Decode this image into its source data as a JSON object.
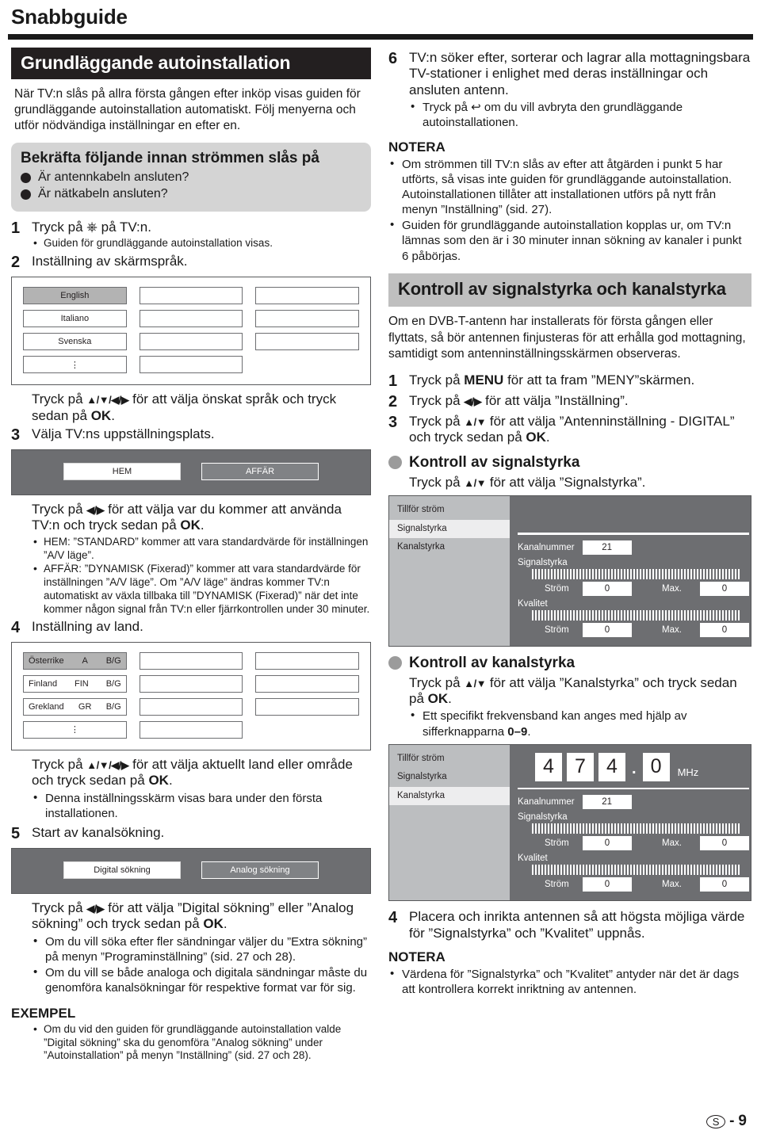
{
  "header": {
    "title": "Snabbguide"
  },
  "left": {
    "banner": "Grundläggande autoinstallation",
    "intro": "När TV:n slås på allra första gången efter inköp visas guiden för grundläggande autoinstallation automatiskt. Följ menyerna och utför nödvändiga inställningar en efter en.",
    "confirm": {
      "title": "Bekräfta följande innan strömmen slås på",
      "items": [
        "Är antennkabeln ansluten?",
        "Är nätkabeln ansluten?"
      ]
    },
    "step1": {
      "num": "1",
      "text_before": "Tryck på",
      "icon": "power-icon",
      "text_after": "på TV:n.",
      "bullets": [
        "Guiden för grundläggande autoinstallation visas."
      ]
    },
    "step2": {
      "num": "2",
      "text": "Inställning av skärmspråk.",
      "language_grid": {
        "col1": [
          "English",
          "Italiano",
          "Svenska",
          "⋮"
        ],
        "col2": [
          "",
          "",
          "",
          ""
        ],
        "col3": [
          "",
          "",
          ""
        ],
        "selected": "English"
      },
      "instruction_before": "Tryck på",
      "keys": "▲/▼/◀/▶",
      "instruction_mid": "för att välja önskat språk och tryck sedan på",
      "ok": "OK",
      "instruction_end": "."
    },
    "step3": {
      "num": "3",
      "text": "Välja TV:ns uppställningsplats.",
      "buttons": {
        "primary": "HEM",
        "secondary": "AFFÄR"
      },
      "instruction_before": "Tryck på",
      "keys": "◀/▶",
      "instruction_mid": "för att välja var du kommer att använda TV:n och tryck sedan på",
      "ok": "OK",
      "instruction_end": ".",
      "bullets": [
        "HEM: ”STANDARD” kommer att vara standardvärde för inställningen ”A/V läge”.",
        "AFFÄR: ”DYNAMISK (Fixerad)” kommer att vara standardvärde för inställningen ”A/V läge”. Om ”A/V läge” ändras kommer TV:n automatiskt av växla tillbaka till ”DYNAMISK (Fixerad)” när det inte kommer någon signal från TV:n eller fjärrkontrollen under 30 minuter."
      ]
    },
    "step4": {
      "num": "4",
      "text": "Inställning av land.",
      "country_grid": {
        "col1": [
          {
            "name": "Österrike",
            "code": "A",
            "system": "B/G"
          },
          {
            "name": "Finland",
            "code": "FIN",
            "system": "B/G"
          },
          {
            "name": "Grekland",
            "code": "GR",
            "system": "B/G"
          },
          {
            "name": "⋮",
            "code": "",
            "system": ""
          }
        ],
        "col2": [
          "",
          "",
          "",
          ""
        ],
        "col3": [
          "",
          "",
          ""
        ],
        "selected": "Österrike"
      },
      "instruction_before": "Tryck på",
      "keys": "▲/▼/◀/▶",
      "instruction_mid": "för att välja aktuellt land eller område och tryck sedan på",
      "ok": "OK",
      "instruction_end": ".",
      "bullets": [
        "Denna inställningsskärm visas bara under den första installationen."
      ]
    },
    "step5": {
      "num": "5",
      "text": "Start av kanalsökning.",
      "buttons": {
        "primary": "Digital sökning",
        "secondary": "Analog sökning"
      },
      "instruction_before": "Tryck på",
      "keys": "◀/▶",
      "instruction_mid": "för att välja ”Digital sökning” eller ”Analog sökning” och tryck sedan på",
      "ok": "OK",
      "instruction_end": ".",
      "bullets": [
        "Om du vill söka efter fler sändningar väljer du ”Extra sökning” på menyn ”Programinställning” (sid. 27 och 28).",
        "Om du vill se både analoga och digitala sändningar måste du genomföra kanalsökningar för respektive format var för sig."
      ]
    },
    "exempel": {
      "title": "EXEMPEL",
      "bullets": [
        "Om du vid den guiden för grundläggande autoinstallation valde ”Digital sökning” ska du genomföra ”Analog sökning” under ”Autoinstallation” på menyn ”Inställning” (sid. 27 och 28)."
      ]
    }
  },
  "right": {
    "step6": {
      "num": "6",
      "text": "TV:n söker efter, sorterar och lagrar alla mottagningsbara TV-stationer i enlighet med deras inställningar och ansluten antenn.",
      "bullet_before": "Tryck på",
      "icon": "return-arrow-icon",
      "bullet_after": "om du vill avbryta den grundläggande autoinstallationen."
    },
    "notera1": {
      "title": "NOTERA",
      "bullets": [
        "Om strömmen till TV:n slås av efter att åtgärden i punkt 5 har utförts, så visas inte guiden för grundläggande autoinstallation. Autoinstallationen tillåter att installationen utförs på nytt från menyn ”Inställning” (sid. 27).",
        "Guiden för grundläggande autoinstallation kopplas ur, om TV:n lämnas som den är i 30 minuter innan sökning av kanaler i punkt 6 påbörjas."
      ]
    },
    "banner": "Kontroll av signalstyrka och kanalstyrka",
    "intro": "Om en DVB-T-antenn har installerats för första gången eller flyttats, så bör antennen finjusteras för att erhålla god mottagning, samtidigt som antenninställningsskärmen observeras.",
    "steps": [
      {
        "num": "1",
        "parts": [
          "Tryck på ",
          "MENU",
          " för att ta fram ”MENY”skärmen."
        ]
      },
      {
        "num": "2",
        "parts": [
          "Tryck på ",
          "◀/▶",
          " för att välja ”Inställning”."
        ]
      },
      {
        "num": "3",
        "parts": [
          "Tryck på ",
          "▲/▼",
          " för att välja ”Antenninställning - DIGITAL” och tryck sedan på ",
          "OK",
          "."
        ]
      }
    ],
    "signal_section": {
      "heading": "Kontroll av signalstyrka",
      "instruction_before": "Tryck på",
      "keys": "▲/▼",
      "instruction_after": "för att välja ”Signalstyrka”.",
      "panel": {
        "menu": [
          "Tillför ström",
          "Signalstyrka",
          "Kanalstyrka"
        ],
        "active": "Signalstyrka",
        "channel_label": "Kanalnummer",
        "channel_value": "21",
        "meters": [
          {
            "caption": "Signalstyrka",
            "current_label": "Ström",
            "current_value": "0",
            "max_label": "Max.",
            "max_value": "0"
          },
          {
            "caption": "Kvalitet",
            "current_label": "Ström",
            "current_value": "0",
            "max_label": "Max.",
            "max_value": "0"
          }
        ]
      }
    },
    "channel_section": {
      "heading": "Kontroll av kanalstyrka",
      "instruction_before": "Tryck på",
      "keys": "▲/▼",
      "instruction_mid": "för att välja ”Kanalstyrka” och tryck sedan på",
      "ok": "OK",
      "instruction_end": ".",
      "bullets_before": "Ett specifikt frekvensband kan anges med hjälp av sifferknapparna",
      "bullets_keys": "0–9",
      "bullets_end": ".",
      "panel": {
        "menu": [
          "Tillför ström",
          "Signalstyrka",
          "Kanalstyrka"
        ],
        "active": "Kanalstyrka",
        "frequency_digits": [
          "4",
          "7",
          "4"
        ],
        "frequency_decimal": "0",
        "frequency_unit": "MHz",
        "channel_label": "Kanalnummer",
        "channel_value": "21",
        "meters": [
          {
            "caption": "Signalstyrka",
            "current_label": "Ström",
            "current_value": "0",
            "max_label": "Max.",
            "max_value": "0"
          },
          {
            "caption": "Kvalitet",
            "current_label": "Ström",
            "current_value": "0",
            "max_label": "Max.",
            "max_value": "0"
          }
        ]
      }
    },
    "step4": {
      "num": "4",
      "text": "Placera och inrikta antennen så att högsta möjliga värde för ”Signalstyrka” och ”Kvalitet” uppnås."
    },
    "notera2": {
      "title": "NOTERA",
      "bullets": [
        "Värdena för ”Signalstyrka” och ”Kvalitet” antyder när det är dags att kontrollera korrekt inriktning av antennen."
      ]
    }
  },
  "footer": {
    "locale": "S",
    "separator": "-",
    "page": "9"
  }
}
